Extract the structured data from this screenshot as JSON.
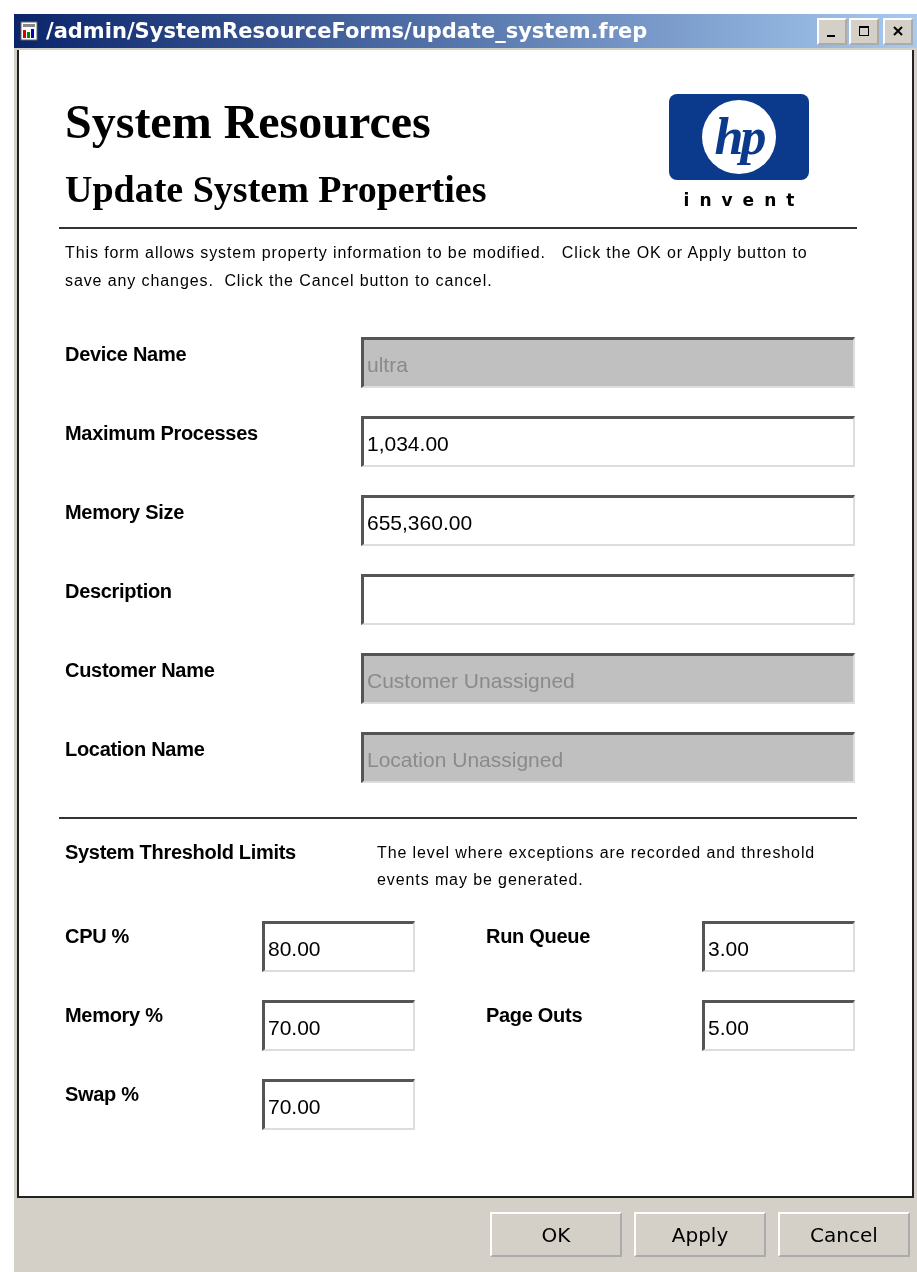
{
  "window": {
    "title": "/admin/SystemResourceForms/update_system.frep"
  },
  "header": {
    "title": "System Resources",
    "subtitle": "Update System Properties",
    "logo": {
      "mark": "hp",
      "tagline": "invent"
    }
  },
  "intro": "This form allows system property information to be modified.   Click the OK or Apply button to save any changes.  Click the Cancel button to cancel.",
  "fields": [
    {
      "label": "Device Name",
      "value": "ultra",
      "disabled": true
    },
    {
      "label": "Maximum Processes",
      "value": "1,034.00",
      "disabled": false
    },
    {
      "label": "Memory Size",
      "value": "655,360.00",
      "disabled": false
    },
    {
      "label": "Description",
      "disabled": false
    },
    {
      "label": "Customer Name",
      "value": "Customer Unassigned",
      "disabled": true
    },
    {
      "label": "Location Name",
      "value": "Location Unassigned",
      "disabled": true
    }
  ],
  "thresholds": {
    "title": "System Threshold Limits",
    "note": "The level where exceptions are recorded and threshold events may be generated.",
    "items": [
      {
        "label": "CPU",
        "unit": "%",
        "value": "80.00"
      },
      {
        "label": "Run Queue",
        "value": "3.00"
      },
      {
        "label": "Memory",
        "unit": "%",
        "value": "70.00"
      },
      {
        "label": "Page Outs",
        "value": "5.00"
      },
      {
        "label": "Swap",
        "unit": "%",
        "value": "70.00"
      }
    ]
  },
  "buttons": [
    "OK",
    "Apply",
    "Cancel"
  ]
}
